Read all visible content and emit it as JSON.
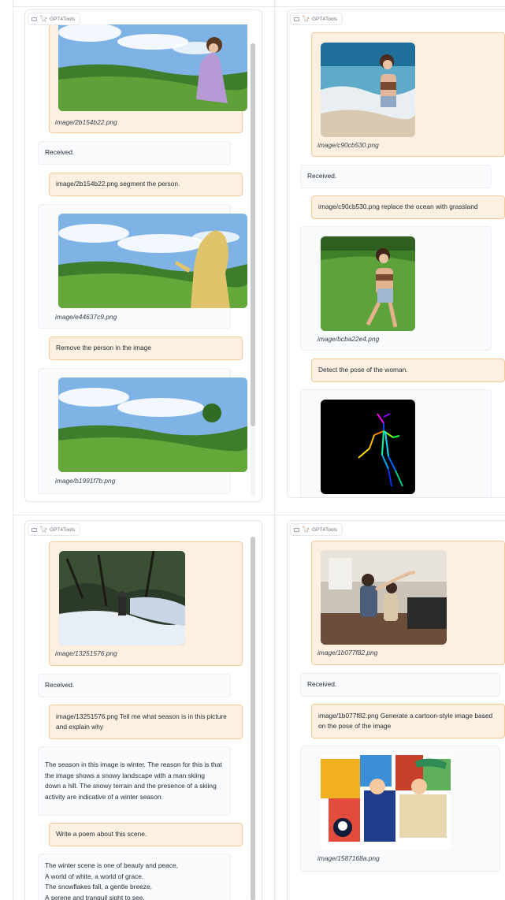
{
  "label": {
    "icon": "chat-icon",
    "emoji": "🦙",
    "text": "GPT4Tools"
  },
  "panel1": {
    "img1_name": "image/2b154b22.png",
    "received": "Received.",
    "u1": "image/2b154b22.png segment the person.",
    "img2_name": "image/e44637c9.png",
    "u2": "Remove the person in the image",
    "img3_name": "image/b1991f7b.png"
  },
  "panel2": {
    "img1_name": "image/c90cb530.png",
    "received": "Received.",
    "u1": "image/c90cb530.png replace the ocean with grassland",
    "img2_name": "image/bcba22e4.png",
    "u2": "Detect the pose of the woman."
  },
  "panel3": {
    "img1_name": "image/13251576.png",
    "received": "Received.",
    "u1": "image/13251576.png Tell me what season is in this picture and explain why",
    "b1": "The season in this image is winter. The reason for this is that the image shows a snowy landscape with a man skiing down a hill. The snowy terrain and the presence of a skiing activity are indicative of a winter season.",
    "u2": "Write a poem about this scene.",
    "poem": [
      "The winter scene is one of beauty and peace,",
      "A world of white, a world of grace.",
      "The snowflakes fall, a gentle breeze,",
      "A serene and tranquil sight to see."
    ]
  },
  "panel4": {
    "img1_name": "image/1b077f82.png",
    "received": "Received.",
    "u1": "image/1b077f82.png Generate a cartoon-style image based on the pose of the image",
    "img2_name": "image/1587168a.png"
  },
  "colors": {
    "user_bg": "#fdf0e1",
    "user_border": "#f5c89a",
    "bot_bg": "#f9fafb"
  }
}
